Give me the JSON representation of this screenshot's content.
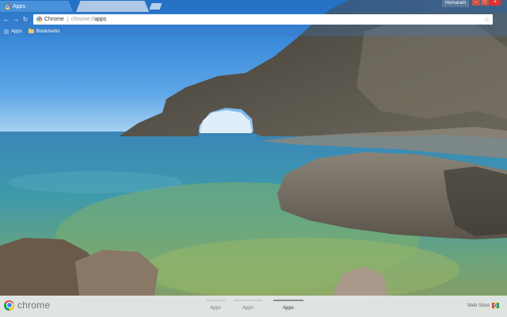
{
  "window": {
    "user_name": "Hemaram",
    "controls": {
      "minimize": "–",
      "maximize": "□",
      "close": "×"
    }
  },
  "tabs": [
    {
      "label": "Apps",
      "active": true,
      "icon": "apps-tab-icon"
    },
    {
      "label": "",
      "active": false
    }
  ],
  "toolbar": {
    "back": "←",
    "forward": "→",
    "reload": "↻",
    "omnibox": {
      "chip_label": "Chrome",
      "url_scheme": "chrome://",
      "url_path": "apps",
      "star": "☆"
    }
  },
  "bookmarks": [
    {
      "label": "Apps",
      "icon": "apps-grid-icon"
    },
    {
      "label": "Bookmarks",
      "icon": "folder-icon"
    }
  ],
  "launcher": {
    "brand": "chrome",
    "pages": [
      {
        "label": "Apps",
        "selected": false
      },
      {
        "label": "Apps",
        "selected": false
      },
      {
        "label": "Apps",
        "selected": true
      }
    ],
    "webstore_label": "Web Store"
  },
  "colors": {
    "tab_active": "#5096dc",
    "bottombar": "#ebeef2",
    "sky": "#2f86d6",
    "sea": "#3b8fb5"
  }
}
